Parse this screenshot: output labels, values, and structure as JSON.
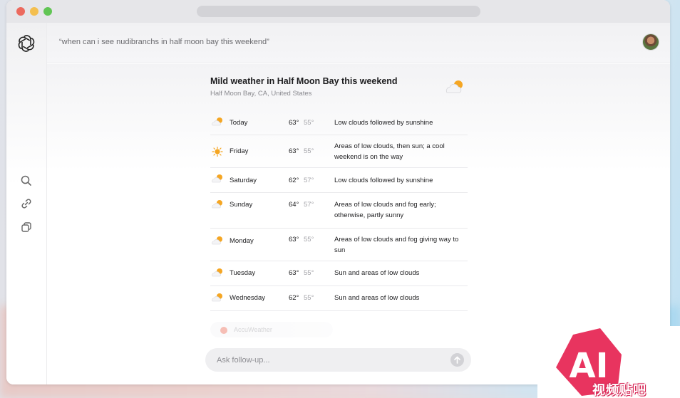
{
  "query": "“when can i see nudibranchs in half moon bay this weekend”",
  "card": {
    "title": "Mild weather in Half Moon Bay this weekend",
    "location": "Half Moon Bay, CA, United States"
  },
  "forecast": [
    {
      "day": "Today",
      "high": "63°",
      "low": "55°",
      "desc": "Low clouds followed by sunshine",
      "icon": "partly-sunny-icon"
    },
    {
      "day": "Friday",
      "high": "63°",
      "low": "55°",
      "desc": "Areas of low clouds, then sun; a cool weekend is on the way",
      "icon": "sunny-icon"
    },
    {
      "day": "Saturday",
      "high": "62°",
      "low": "57°",
      "desc": "Low clouds followed by sunshine",
      "icon": "partly-sunny-icon"
    },
    {
      "day": "Sunday",
      "high": "64°",
      "low": "57°",
      "desc": "Areas of low clouds and fog early; otherwise, partly sunny",
      "icon": "partly-sunny-icon"
    },
    {
      "day": "Monday",
      "high": "63°",
      "low": "55°",
      "desc": "Areas of low clouds and fog giving way to sun",
      "icon": "partly-sunny-icon"
    },
    {
      "day": "Tuesday",
      "high": "63°",
      "low": "55°",
      "desc": "Sun and areas of low clouds",
      "icon": "partly-sunny-icon"
    },
    {
      "day": "Wednesday",
      "high": "62°",
      "low": "55°",
      "desc": "Sun and areas of low clouds",
      "icon": "partly-sunny-icon"
    }
  ],
  "source": {
    "label": "AccuWeather"
  },
  "followup": {
    "placeholder": "Ask follow-up..."
  },
  "watermark": {
    "brand": "AI",
    "label": "视频贴吧"
  },
  "colors": {
    "accent_sun": "#f5a623",
    "watermark": "#e8345f"
  },
  "icons": {
    "logo": "openai-logo",
    "sidebar": [
      "search-icon",
      "link-icon",
      "copy-icon"
    ],
    "hero": "partly-sunny-icon",
    "send": "arrow-up-icon"
  }
}
